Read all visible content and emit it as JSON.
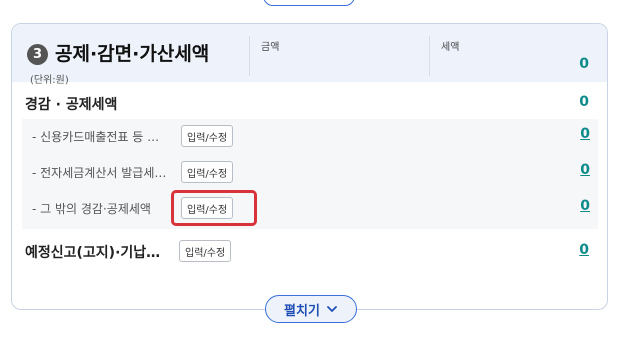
{
  "section": {
    "number": "3",
    "title": "공제·감면·가산세액",
    "unit": "(단위:원)",
    "col_amount": "금액",
    "col_tax": "세액",
    "total_value": "0"
  },
  "rows": {
    "reduction": {
      "label": "경감 · 공제세액",
      "value": "0"
    },
    "card_sales": {
      "label": "- 신용카드매출전표 등 …",
      "button": "입력/수정",
      "value": "0"
    },
    "e_invoice": {
      "label": "- 전자세금계산서 발급세…",
      "button": "입력/수정",
      "value": "0"
    },
    "other_reduction": {
      "label": "- 그 밖의 경감·공제세액",
      "button": "입력/수정",
      "value": "0"
    },
    "prepaid": {
      "label": "예정신고(고지)·기납…",
      "button": "입력/수정",
      "value": "0"
    }
  },
  "expand": {
    "label": "펼치기"
  },
  "colors": {
    "accent": "#3a6fd8",
    "value_teal": "#0f8a8a",
    "highlight": "#d8333a"
  }
}
